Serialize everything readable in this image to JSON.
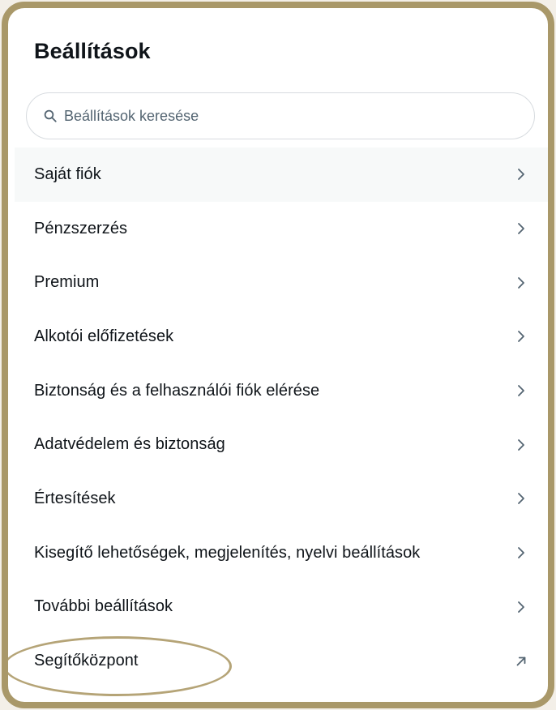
{
  "settings": {
    "title": "Beállítások",
    "search": {
      "placeholder": "Beállítások keresése",
      "value": ""
    },
    "items": [
      {
        "label": "Saját fiók",
        "icon": "chevron-right-icon"
      },
      {
        "label": "Pénzszerzés",
        "icon": "chevron-right-icon"
      },
      {
        "label": "Premium",
        "icon": "chevron-right-icon"
      },
      {
        "label": "Alkotói előfizetések",
        "icon": "chevron-right-icon"
      },
      {
        "label": "Biztonság és a felhasználói fiók elérése",
        "icon": "chevron-right-icon"
      },
      {
        "label": "Adatvédelem és biztonság",
        "icon": "chevron-right-icon"
      },
      {
        "label": "Értesítések",
        "icon": "chevron-right-icon"
      },
      {
        "label": "Kisegítő lehetőségek, megjelenítés, nyelvi beállítások",
        "icon": "chevron-right-icon"
      },
      {
        "label": "További beállítások",
        "icon": "chevron-right-icon"
      },
      {
        "label": "Segítőközpont",
        "icon": "external-link-arrow-icon"
      }
    ]
  },
  "colors": {
    "frame_border": "#a99869",
    "highlight_circle": "#b5a477",
    "text_primary": "#0f1419",
    "text_secondary": "#536471",
    "active_row_bg": "#f7f9f9"
  }
}
